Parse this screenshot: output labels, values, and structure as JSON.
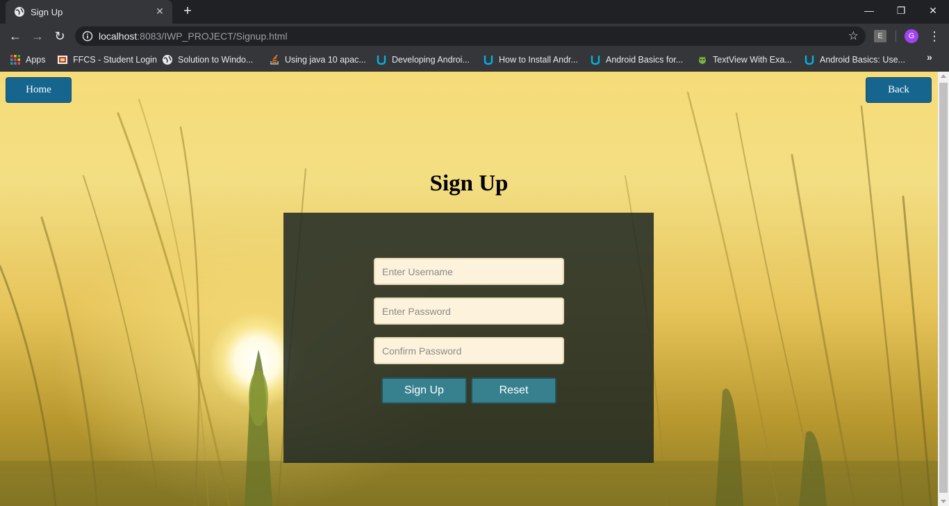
{
  "browser": {
    "tab": {
      "title": "Sign Up"
    },
    "url": {
      "host": "localhost",
      "rest": ":8083/IWP_PROJECT/Signup.html"
    },
    "profile_initial": "G",
    "extension_label": "E",
    "bookmarks": [
      {
        "label": "Apps",
        "icon": "apps-grid-icon"
      },
      {
        "label": "FFCS - Student Login",
        "icon": "ffcs-icon"
      },
      {
        "label": "Solution to Windo...",
        "icon": "globe-icon"
      },
      {
        "label": "Using java 10 apac...",
        "icon": "stackoverflow-icon"
      },
      {
        "label": "Developing Androi...",
        "icon": "udacity-icon"
      },
      {
        "label": "How to Install Andr...",
        "icon": "udacity-icon"
      },
      {
        "label": "Android Basics for...",
        "icon": "udacity-icon"
      },
      {
        "label": "TextView With Exa...",
        "icon": "android-icon"
      },
      {
        "label": "Android Basics: Use...",
        "icon": "udacity-icon"
      }
    ]
  },
  "page": {
    "home_label": "Home",
    "back_label": "Back",
    "heading": "Sign Up",
    "form": {
      "username_placeholder": "Enter Username",
      "password_placeholder": "Enter Password",
      "confirm_placeholder": "Confirm Password",
      "signup_label": "Sign Up",
      "reset_label": "Reset"
    }
  },
  "colors": {
    "nav_button": "#15658f",
    "form_button": "#37818f",
    "panel": "#1e2823",
    "field_bg": "#fdf3dc"
  }
}
